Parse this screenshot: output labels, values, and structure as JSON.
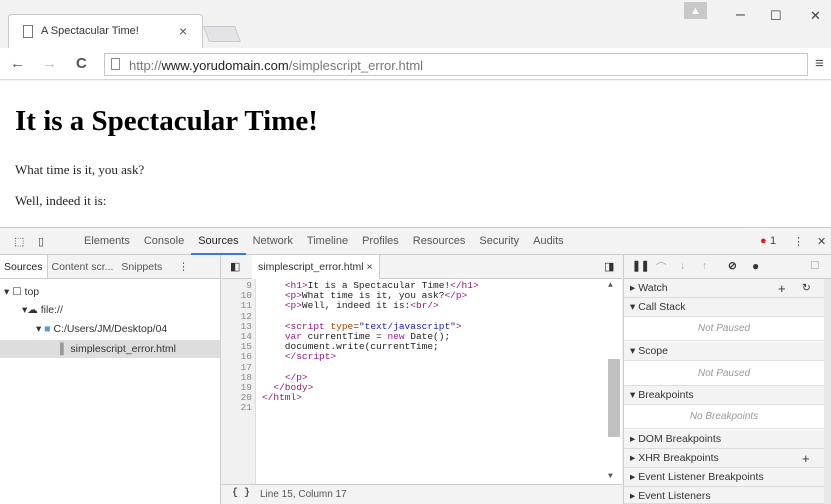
{
  "browser": {
    "tab_title": "A Spectacular Time!",
    "tab_close": "×",
    "profile_icon": "person-icon",
    "window_buttons": {
      "minimize": "–",
      "maximize": "☐",
      "close": "✕"
    },
    "url_prefix": "http://",
    "url_domain": "www.yorudomain.com",
    "url_path": "/simplescript_error.html",
    "back": "←",
    "forward": "→",
    "reload": "C",
    "menu": "≡"
  },
  "page": {
    "heading": "It is a Spectacular Time!",
    "para1": "What time is it, you ask?",
    "para2": "Well, indeed it is:"
  },
  "devtools": {
    "tabs": [
      "Elements",
      "Console",
      "Sources",
      "Network",
      "Timeline",
      "Profiles",
      "Resources",
      "Security",
      "Audits"
    ],
    "active_tab": "Sources",
    "error_count": "1",
    "nav_tabs": [
      "Sources",
      "Content scr...",
      "Snippets"
    ],
    "tree": {
      "top": "top",
      "origin": "file://",
      "folder": "C:/Users/JM/Desktop/04",
      "file": "simplescript_error.html"
    },
    "editor_file": "simplescript_error.html ×",
    "code_lines": [
      {
        "n": "9",
        "html": "    <span class='tag'>&lt;h1&gt;</span>It is a Spectacular Time!<span class='tag'>&lt;/h1&gt;</span>"
      },
      {
        "n": "10",
        "html": "    <span class='tag'>&lt;p&gt;</span>What time is it, you ask?<span class='tag'>&lt;/p&gt;</span>"
      },
      {
        "n": "11",
        "html": "    <span class='tag'>&lt;p&gt;</span>Well, indeed it is:<span class='tag'>&lt;br/&gt;</span>"
      },
      {
        "n": "12",
        "html": ""
      },
      {
        "n": "13",
        "html": "    <span class='tag'>&lt;script</span> <span class='attr'>type</span>=<span class='str'>\"text/javascript\"</span><span class='tag'>&gt;</span>"
      },
      {
        "n": "14",
        "html": "    <span class='kw'>var</span> currentTime = <span class='kw'>new</span> Date();"
      },
      {
        "n": "15",
        "html": "    document.write(currentTime;"
      },
      {
        "n": "16",
        "html": "    <span class='tag'>&lt;/script&gt;</span>"
      },
      {
        "n": "17",
        "html": ""
      },
      {
        "n": "18",
        "html": "    <span class='tag'>&lt;/p&gt;</span>"
      },
      {
        "n": "19",
        "html": "  <span class='tag'>&lt;/body&gt;</span>"
      },
      {
        "n": "20",
        "html": "<span class='tag'>&lt;/html&gt;</span>"
      },
      {
        "n": "21",
        "html": ""
      }
    ],
    "status": "Line 15, Column 17",
    "status_icon": "{ }",
    "debugger": {
      "watch": "Watch",
      "call_stack": "Call Stack",
      "not_paused": "Not Paused",
      "scope": "Scope",
      "not_paused2": "Not Paused",
      "breakpoints": "Breakpoints",
      "no_breakpoints": "No Breakpoints",
      "dom_breakpoints": "DOM Breakpoints",
      "xhr_breakpoints": "XHR Breakpoints",
      "event_listener_breakpoints": "Event Listener Breakpoints",
      "event_listeners": "Event Listeners"
    }
  }
}
